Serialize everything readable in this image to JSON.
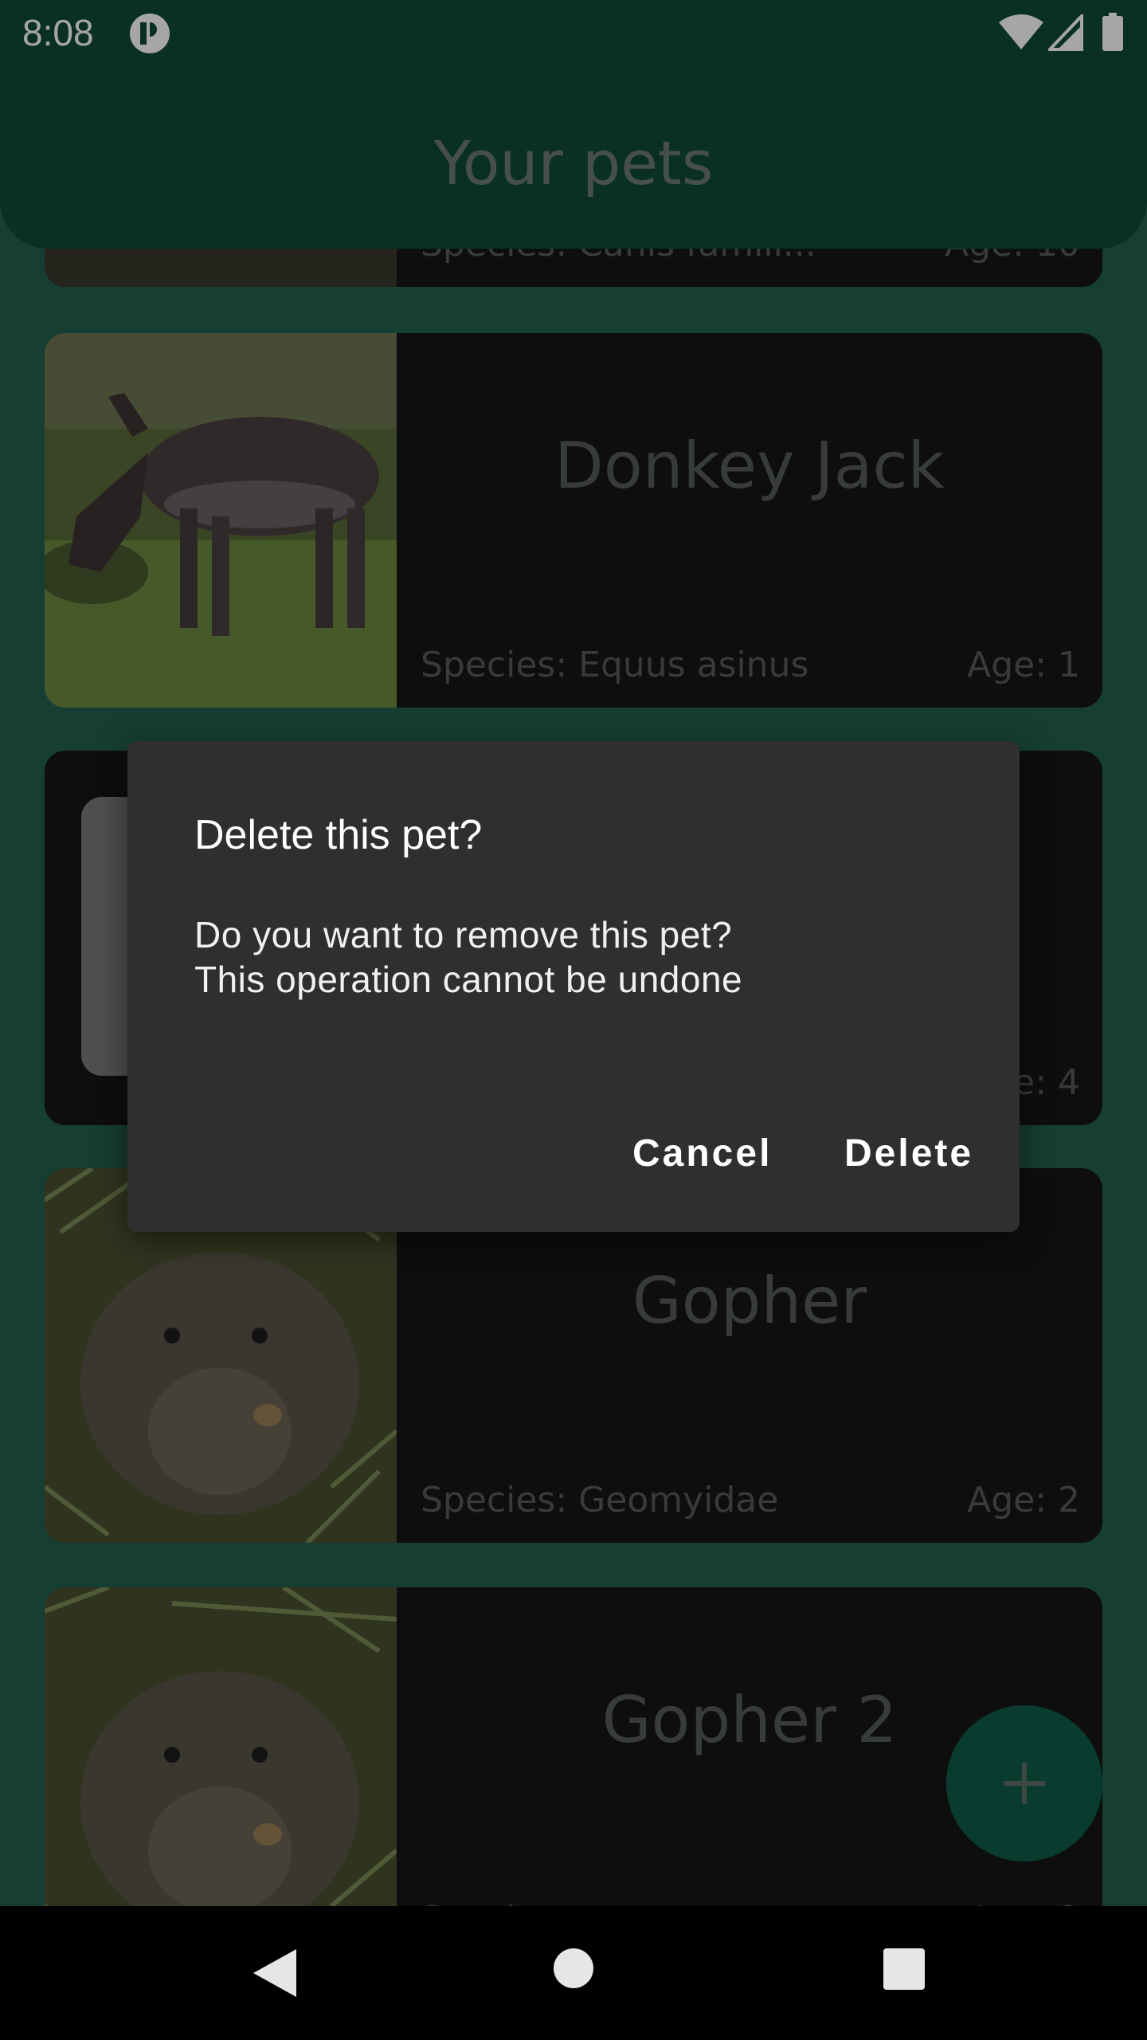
{
  "status_bar": {
    "time": "8:08",
    "icons": [
      "app-notification-icon",
      "wifi-icon",
      "signal-icon",
      "battery-icon"
    ]
  },
  "app_bar": {
    "title": "Your pets"
  },
  "pets": [
    {
      "name": "",
      "species": "Species: Canis famili...",
      "age": "Age: 10"
    },
    {
      "name": "Donkey Jack",
      "species": "Species: Equus asinus",
      "age": "Age: 1"
    },
    {
      "name": "",
      "species": "",
      "age": "e: 4"
    },
    {
      "name": "Gopher",
      "species": "Species: Geomyidae",
      "age": "Age: 2"
    },
    {
      "name": "Gopher 2",
      "species": "Species:",
      "age": "Age: 2"
    }
  ],
  "fab": {
    "icon": "plus-icon"
  },
  "dialog": {
    "title": "Delete this pet?",
    "message_line1": "Do you want to remove this pet?",
    "message_line2": "This operation cannot be undone",
    "cancel_label": "Cancel",
    "delete_label": "Delete"
  },
  "nav_bar": {
    "icons": [
      "back-icon",
      "home-icon",
      "recents-icon"
    ]
  },
  "colors": {
    "primary": "#104a3b",
    "fab": "#0f5c47",
    "card": "#161616",
    "dialog": "#2f2f2f"
  }
}
